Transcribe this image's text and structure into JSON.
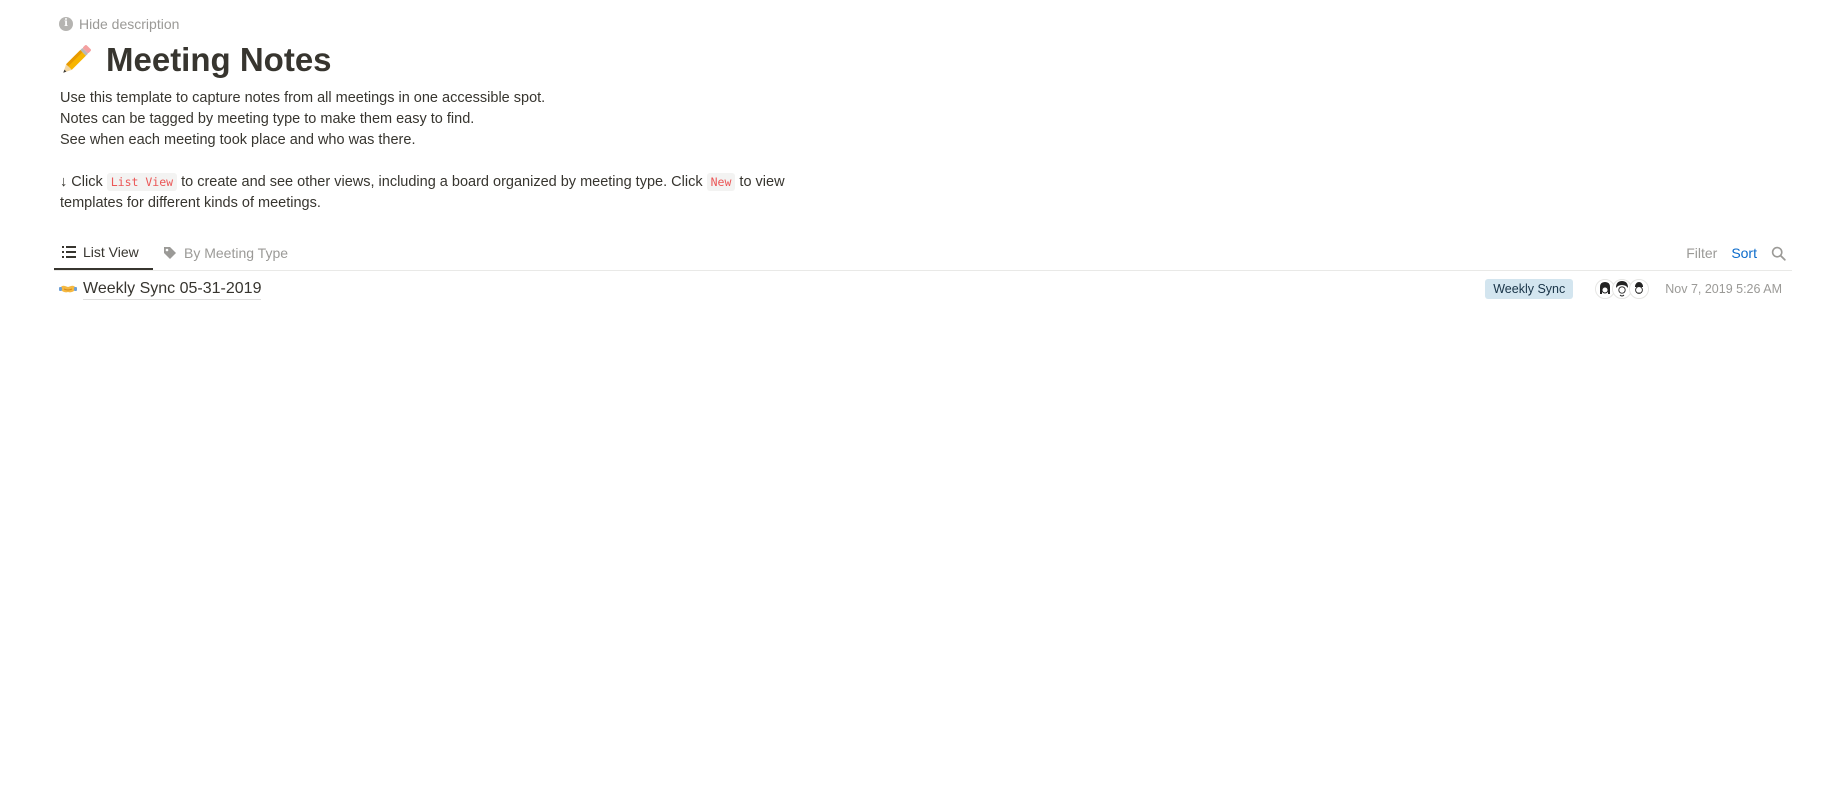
{
  "header": {
    "hide_description": "Hide description",
    "title_emoji": "✏️",
    "title": "Meeting Notes"
  },
  "description": {
    "line1": "Use this template to capture notes from all meetings in one accessible spot.",
    "line2": "Notes can be tagged by meeting type to make them easy to find.",
    "line3": "See when each meeting took place and who was there.",
    "line4_part1": "↓ Click ",
    "line4_code1": "List View",
    "line4_part2": " to create and see other views, including a board organized by meeting type. Click ",
    "line4_code2": "New",
    "line4_part3": " to view",
    "line5": "templates for different kinds of meetings."
  },
  "tabs": [
    {
      "label": "List View",
      "icon": "list-icon",
      "active": true
    },
    {
      "label": "By Meeting Type",
      "icon": "tag-icon",
      "active": false
    }
  ],
  "toolbar": {
    "filter": "Filter",
    "sort": "Sort",
    "search_icon": "search-icon"
  },
  "rows": [
    {
      "emoji": "🤝",
      "title": "Weekly Sync 05-31-2019",
      "tag": "Weekly Sync",
      "attendee_count": 3,
      "date": "Nov 7, 2019 5:26 AM"
    }
  ],
  "colors": {
    "text": "#37352f",
    "muted": "#9b9a97",
    "accent": "#0b6bcb",
    "code_red": "#eb5757",
    "tag_bg": "#d3e5ef"
  }
}
